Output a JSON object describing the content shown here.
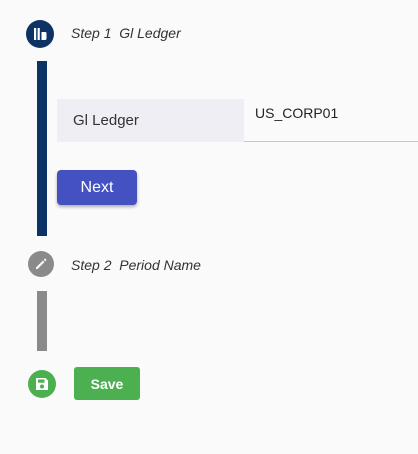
{
  "colors": {
    "step1_accent": "#0d3366",
    "step2_accent": "#8a8a8a",
    "primary_button": "#4352c0",
    "save_button": "#4caf50"
  },
  "steps": [
    {
      "label": "Step 1  Gl Ledger",
      "icon": "ledger-icon",
      "state": "active"
    },
    {
      "label": "Step 2  Period Name",
      "icon": "pencil-icon",
      "state": "pending"
    }
  ],
  "form": {
    "gl_ledger_label": "Gl Ledger",
    "gl_ledger_value": "US_CORP01"
  },
  "buttons": {
    "next_label": "Next",
    "save_label": "Save"
  },
  "save_icon": "save-icon"
}
